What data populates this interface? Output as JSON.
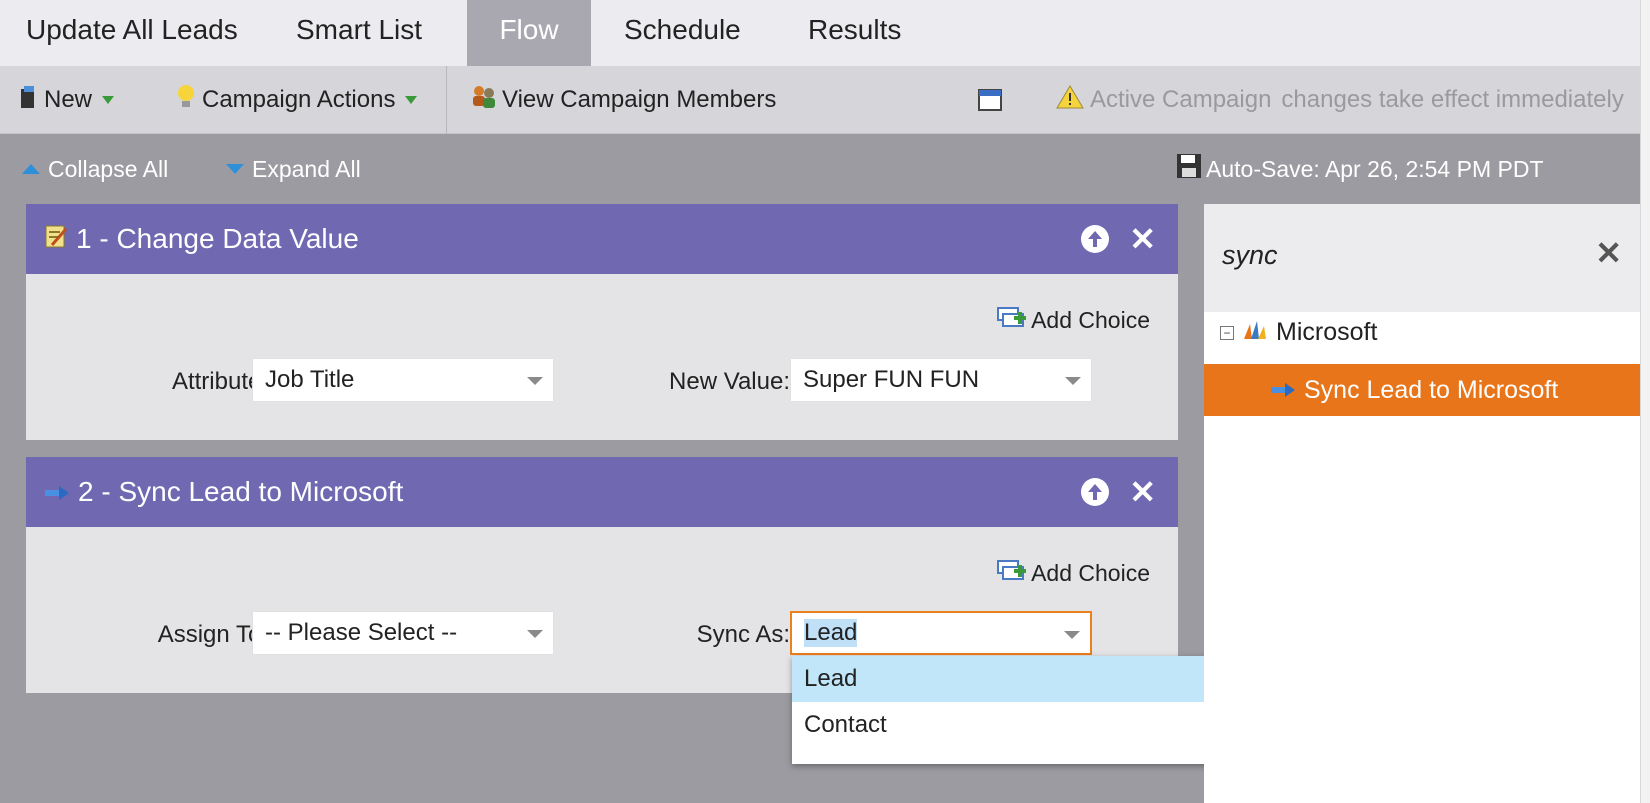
{
  "tabs": [
    {
      "label": "Update All Leads",
      "active": false
    },
    {
      "label": "Smart List",
      "active": false
    },
    {
      "label": "Flow",
      "active": true
    },
    {
      "label": "Schedule",
      "active": false
    },
    {
      "label": "Results",
      "active": false
    }
  ],
  "toolbar": {
    "new_label": "New",
    "campaign_actions_label": "Campaign Actions",
    "view_members_label": "View Campaign Members",
    "status_label": "Active Campaign",
    "status_note": "changes take effect immediately"
  },
  "subbar": {
    "collapse_label": "Collapse All",
    "expand_label": "Expand All",
    "autosave": "Auto-Save: Apr 26, 2:54 PM PDT"
  },
  "steps": [
    {
      "title": "1 - Change Data Value",
      "add_choice": "Add Choice",
      "field1_label": "Attribute:",
      "field1_value": "Job Title",
      "field2_label": "New Value:",
      "field2_value": "Super FUN FUN"
    },
    {
      "title": "2 - Sync Lead to Microsoft",
      "add_choice": "Add Choice",
      "field1_label": "Assign To:",
      "field1_value": "-- Please Select --",
      "field2_label": "Sync As:",
      "field2_value": "Lead"
    }
  ],
  "dropdown": {
    "options": [
      "Lead",
      "Contact"
    ],
    "highlighted": "Lead"
  },
  "panel": {
    "search": "sync",
    "group": "Microsoft",
    "selected_item": "Sync Lead to Microsoft"
  },
  "colors": {
    "step_header": "#7068b1",
    "selection": "#e8751a",
    "focus_border": "#e9811f"
  }
}
